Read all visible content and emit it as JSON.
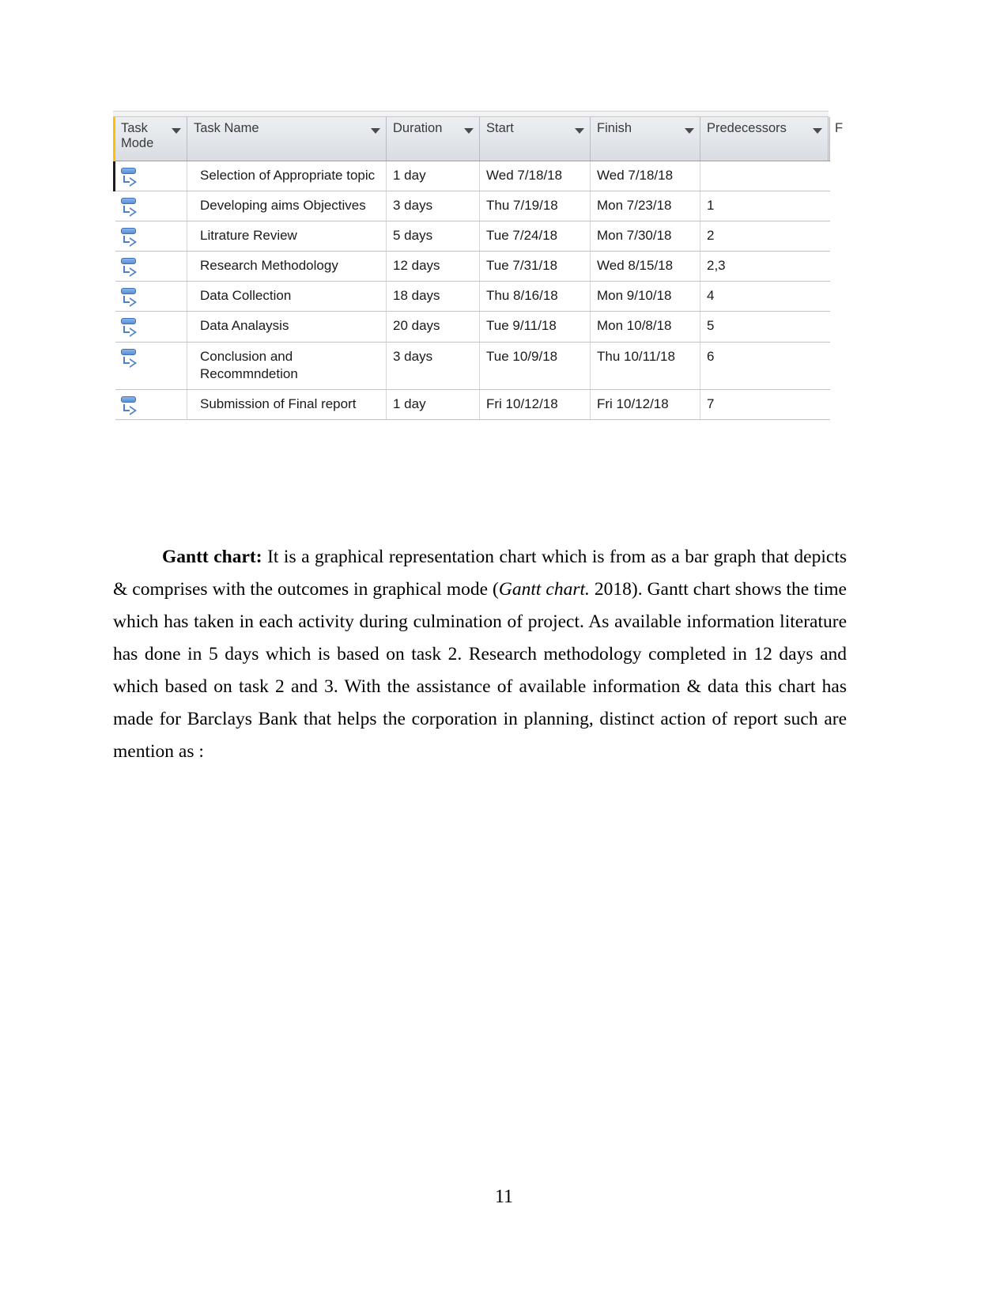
{
  "document": {
    "page_number": "11"
  },
  "project_table": {
    "columns": [
      {
        "key": "task_mode",
        "label": "Task Mode",
        "has_filter": true
      },
      {
        "key": "task_name",
        "label": "Task Name",
        "has_filter": true
      },
      {
        "key": "duration",
        "label": "Duration",
        "has_filter": true
      },
      {
        "key": "start",
        "label": "Start",
        "has_filter": true
      },
      {
        "key": "finish",
        "label": "Finish",
        "has_filter": true
      },
      {
        "key": "predecessors",
        "label": "Predecessors",
        "has_filter": true
      },
      {
        "key": "clipped",
        "label": "F",
        "has_filter": false
      }
    ],
    "mode_icon": "auto-schedule-icon",
    "rows": [
      {
        "task_name": "Selection of Appropriate topic",
        "duration": "1 day",
        "start": "Wed 7/18/18",
        "finish": "Wed 7/18/18",
        "predecessors": ""
      },
      {
        "task_name": "Developing aims Objectives",
        "duration": "3 days",
        "start": "Thu 7/19/18",
        "finish": "Mon 7/23/18",
        "predecessors": "1"
      },
      {
        "task_name": "Litrature Review",
        "duration": "5 days",
        "start": "Tue 7/24/18",
        "finish": "Mon 7/30/18",
        "predecessors": "2"
      },
      {
        "task_name": "Research Methodology",
        "duration": "12 days",
        "start": "Tue 7/31/18",
        "finish": "Wed 8/15/18",
        "predecessors": "2,3"
      },
      {
        "task_name": "Data Collection",
        "duration": "18 days",
        "start": "Thu 8/16/18",
        "finish": "Mon 9/10/18",
        "predecessors": "4"
      },
      {
        "task_name": "Data Analaysis",
        "duration": "20 days",
        "start": "Tue 9/11/18",
        "finish": "Mon 10/8/18",
        "predecessors": "5"
      },
      {
        "task_name": "Conclusion and Recommndetion",
        "duration": "3 days",
        "start": "Tue 10/9/18",
        "finish": "Thu 10/11/18",
        "predecessors": "6"
      },
      {
        "task_name": "Submission of Final report",
        "duration": "1 day",
        "start": "Fri 10/12/18",
        "finish": "Fri 10/12/18",
        "predecessors": "7"
      }
    ]
  },
  "paragraph": {
    "lead_label": "Gantt chart:",
    "text_part_1": " It is a graphical representation chart which is from as a bar graph that depicts & comprises with the outcomes in graphical mode (",
    "citation_italic": "Gantt chart.",
    "text_part_2": "  2018). Gantt chart shows the time which has taken in each activity during culmination of project. As available information literature has done in 5 days which is based on task 2. Research methodology completed in 12 days and which based on task 2 and 3. With the assistance of available information & data this chart has made for Barclays Bank that helps the corporation in  planning, distinct action of report such are mention as :"
  },
  "colors": {
    "header_accent": "#ffc000",
    "header_bg": "#e2e6ea",
    "grid_line": "#c3c3c3",
    "task_icon": "#5b8fd4"
  }
}
